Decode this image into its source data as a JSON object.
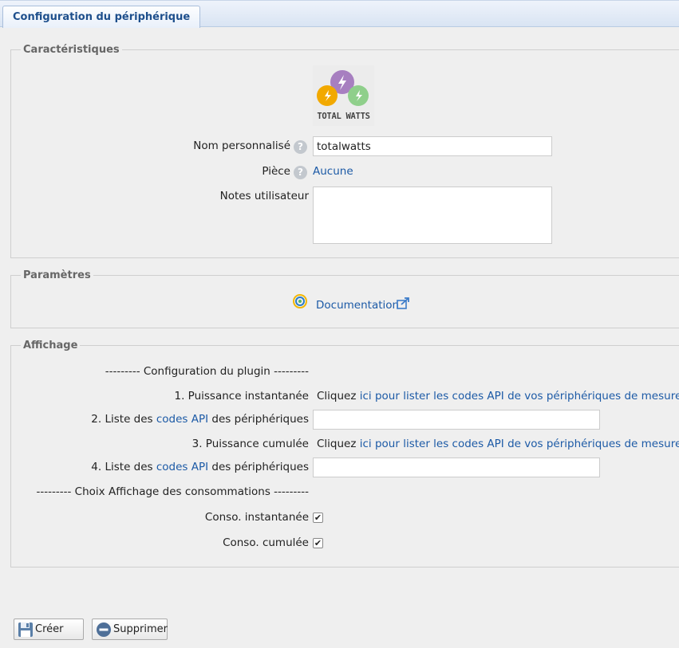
{
  "tab": {
    "label": "Configuration du périphérique"
  },
  "characteristics": {
    "legend": "Caractéristiques",
    "logo_text": "TOTAL WATTS",
    "name_label": "Nom personnalisé",
    "name_value": "totalwatts",
    "room_label": "Pièce",
    "room_value": "Aucune",
    "notes_label": "Notes utilisateur",
    "help_glyph": "?"
  },
  "params": {
    "legend": "Paramètres",
    "doc_link": "Documentation"
  },
  "display": {
    "legend": "Affichage",
    "plugin_header": "--------- Configuration du plugin ---------",
    "row1_label": "1. Puissance instantanée",
    "row1_prefix": "Cliquez",
    "row1_link": "ici pour lister les codes API de vos périphériques de mesure",
    "row2_prefix": "2. Liste des",
    "row2_link": "codes API",
    "row2_suffix": "des périphériques",
    "row2_value": "",
    "row3_label": "3. Puissance cumulée",
    "row3_prefix": "Cliquez",
    "row3_link": "ici pour lister les codes API de vos périphériques de mesure",
    "row4_prefix": "4. Liste des",
    "row4_link": "codes API",
    "row4_suffix": "des périphériques",
    "row4_value": "",
    "choice_header": "--------- Choix Affichage des consommations ---------",
    "conso_inst_label": "Conso. instantanée",
    "conso_inst_checked": true,
    "conso_cum_label": "Conso. cumulée",
    "conso_cum_checked": true,
    "check_glyph": "✔"
  },
  "buttons": {
    "create": "Créer",
    "delete": "Supprimer"
  },
  "colors": {
    "link": "#1c5aa6",
    "logo_purple": "#a77fc0",
    "logo_orange": "#f2a900",
    "logo_green": "#8fcf8b"
  }
}
